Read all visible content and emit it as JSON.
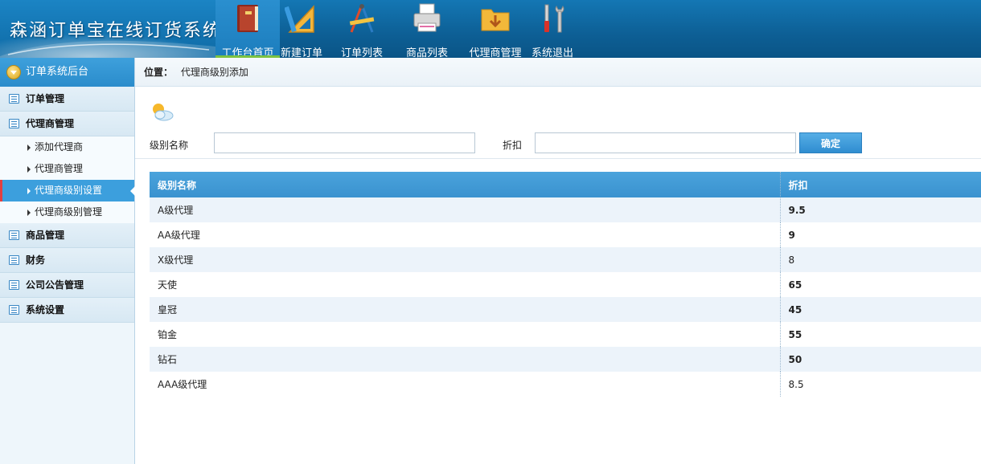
{
  "app": {
    "title": "森涵订单宝在线订货系统"
  },
  "nav": [
    {
      "label": "工作台首页",
      "icon": "book-icon",
      "active": true
    },
    {
      "label": "新建订单",
      "icon": "ruler-triangle-icon",
      "active": false
    },
    {
      "label": "订单列表",
      "icon": "drafting-tools-icon",
      "active": false
    },
    {
      "label": "商品列表",
      "icon": "printer-icon",
      "active": false
    },
    {
      "label": "代理商管理",
      "icon": "download-folder-icon",
      "active": false
    },
    {
      "label": "系统退出",
      "icon": "tools-icon",
      "active": false
    }
  ],
  "sidebar": {
    "header": "订单系统后台",
    "groups": [
      {
        "label": "订单管理",
        "icon": "list-icon"
      },
      {
        "label": "代理商管理",
        "icon": "edit-icon",
        "items": [
          {
            "label": "添加代理商"
          },
          {
            "label": "代理商管理"
          },
          {
            "label": "代理商级别设置",
            "active": true
          },
          {
            "label": "代理商级别管理"
          }
        ]
      },
      {
        "label": "商品管理",
        "icon": "edit-icon"
      },
      {
        "label": "财务",
        "icon": "calendar-icon"
      },
      {
        "label": "公司公告管理",
        "icon": "calendar-icon"
      },
      {
        "label": "系统设置",
        "icon": "calendar-icon"
      }
    ]
  },
  "breadcrumb": {
    "prefix": "位置：",
    "current": "代理商级别添加"
  },
  "form": {
    "level_name_label": "级别名称",
    "level_name_value": "",
    "discount_label": "折扣",
    "discount_value": "",
    "submit_label": "确定"
  },
  "table": {
    "headers": [
      "级别名称",
      "折扣"
    ],
    "rows": [
      {
        "name": "A级代理",
        "discount": "9.5"
      },
      {
        "name": "AA级代理",
        "discount": "9"
      },
      {
        "name": "X级代理",
        "discount": "8"
      },
      {
        "name": "天使",
        "discount": "65"
      },
      {
        "name": "皇冠",
        "discount": "45"
      },
      {
        "name": "铂金",
        "discount": "55"
      },
      {
        "name": "钻石",
        "discount": "50"
      },
      {
        "name": "AAA级代理",
        "discount": "8.5"
      }
    ]
  }
}
